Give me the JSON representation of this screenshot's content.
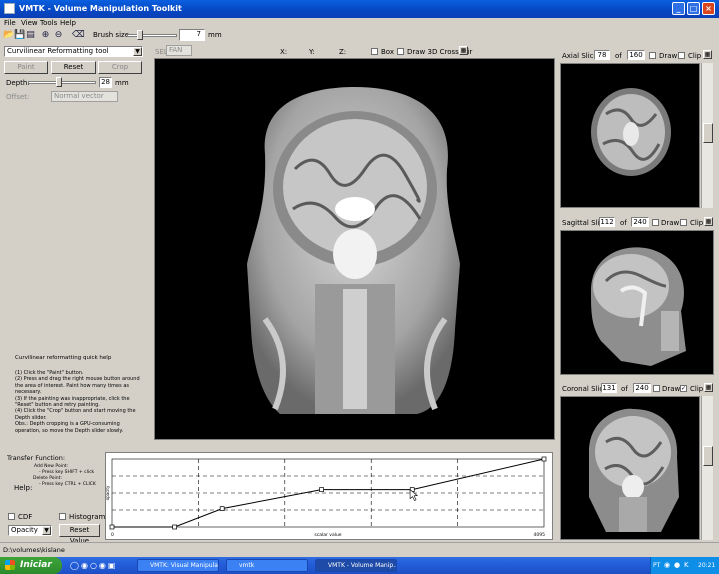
{
  "window": {
    "title": "VMTK - Volume Manipulation Toolkit",
    "controls": {
      "minimize": "_",
      "maximize": "□",
      "close": "×"
    }
  },
  "menu": [
    "File",
    "View",
    "Tools",
    "Help"
  ],
  "toolbar": {
    "brush_size_label": "Brush size",
    "brush_size_value": "7",
    "brush_size_unit": "mm",
    "sel_label": "SEL",
    "sel_value": "FAN",
    "coord_x": "X:",
    "coord_y": "Y:",
    "coord_z": "Z:",
    "box_label": "Box",
    "draw_crosshair_label": "Draw 3D Crosshair"
  },
  "left_panel": {
    "tool_select": "Curvilinear Reformatting tool",
    "paint_label": "Paint",
    "reset_label": "Reset",
    "crop_label": "Crop",
    "depth_label": "Depth:",
    "depth_value": "28",
    "depth_unit": "mm",
    "offset_label": "Offset:",
    "offset_select": "Normal vector",
    "help_title": "Curvilinear reformatting quick help",
    "help_lines": [
      "(1) Click the \"Paint\" button.",
      "(2) Press and drag the right mouse button around",
      "the area of interest. Paint how many times as",
      "necessary.",
      "(3) If the painting was inappropriate, click the",
      "\"Reset\" button and retry painting.",
      "(4) Click the \"Crop\" button and start moving the",
      "Depth slider.",
      "Obs.: Depth cropping is a GPU-consuming",
      "operation, so move the Depth slider slowly."
    ]
  },
  "slices": {
    "of_label": "of",
    "draw_label": "Draw",
    "clip_label": "Clip",
    "axial": {
      "label": "Axial Slice",
      "value": "78",
      "total": "160"
    },
    "sagittal": {
      "label": "Sagittal Slice",
      "value": "112",
      "total": "240"
    },
    "coronal": {
      "label": "Coronal Slice",
      "value": "131",
      "total": "240"
    }
  },
  "transfer_function": {
    "title": "Transfer Function:",
    "help_label": "Help:",
    "help_lines": [
      "Add New Point:",
      "- Press key SHIFT + click",
      "Delete Point:",
      "- Press key CTRL + CLICK"
    ],
    "cdf_label": "CDF",
    "histogram_label": "Histogram",
    "mode_select": "Opacity",
    "reset_label": "Reset Value",
    "x_axis_label": "scalar value",
    "y_axis_label": "opacity",
    "x_start": "0",
    "x_end": "4095",
    "points": [
      {
        "x": 0,
        "y": 0.0
      },
      {
        "x": 0.145,
        "y": 0.0
      },
      {
        "x": 0.255,
        "y": 0.27
      },
      {
        "x": 0.485,
        "y": 0.55
      },
      {
        "x": 0.695,
        "y": 0.55
      },
      {
        "x": 1.0,
        "y": 1.0
      }
    ],
    "cursor_x": 0.69,
    "cursor_y": 0.55
  },
  "status": {
    "path": "D:\\volumes\\kislane"
  },
  "taskbar": {
    "start_label": "Iniciar",
    "tasks": [
      {
        "label": "VMTK: Visual Manipula..."
      },
      {
        "label": "vmtk"
      },
      {
        "label": "VMTK - Volume Manip..."
      }
    ],
    "tray_lang": "PT",
    "clock": "20:21"
  },
  "colors": {
    "titlebar": "#0a5fe0",
    "panel": "#d4d0c8",
    "viewport": "#000000",
    "taskbar": "#245edb",
    "start": "#3ea43a"
  }
}
